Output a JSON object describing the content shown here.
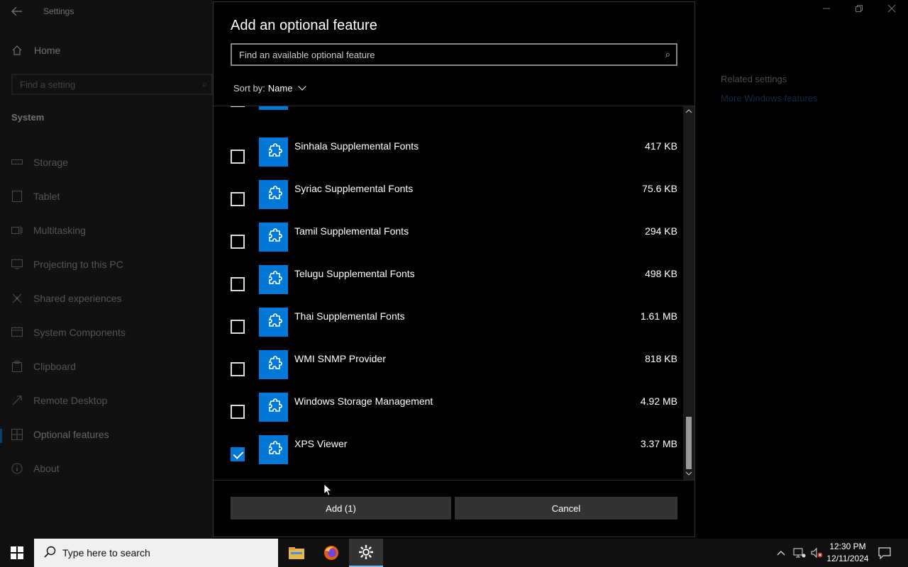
{
  "window": {
    "title": "Settings",
    "back_icon": "back-arrow-icon"
  },
  "sidebar": {
    "home_label": "Home",
    "search_placeholder": "Find a setting",
    "section_label": "System",
    "items": [
      {
        "label": "Storage",
        "icon": "storage-icon"
      },
      {
        "label": "Tablet",
        "icon": "tablet-icon"
      },
      {
        "label": "Multitasking",
        "icon": "multitasking-icon"
      },
      {
        "label": "Projecting to this PC",
        "icon": "projecting-icon"
      },
      {
        "label": "Shared experiences",
        "icon": "shared-experiences-icon"
      },
      {
        "label": "System Components",
        "icon": "system-components-icon"
      },
      {
        "label": "Clipboard",
        "icon": "clipboard-icon"
      },
      {
        "label": "Remote Desktop",
        "icon": "remote-desktop-icon"
      },
      {
        "label": "Optional features",
        "icon": "optional-features-icon",
        "active": true
      },
      {
        "label": "About",
        "icon": "info-icon"
      }
    ]
  },
  "related": {
    "heading": "Related settings",
    "link": "More Windows features"
  },
  "dialog": {
    "title": "Add an optional feature",
    "search_placeholder": "Find an available optional feature",
    "sort_label": "Sort by:",
    "sort_value": "Name",
    "features": [
      {
        "name": "Sinhala Supplemental Fonts",
        "size": "417 KB",
        "checked": false
      },
      {
        "name": "Syriac Supplemental Fonts",
        "size": "75.6 KB",
        "checked": false
      },
      {
        "name": "Tamil Supplemental Fonts",
        "size": "294 KB",
        "checked": false
      },
      {
        "name": "Telugu Supplemental Fonts",
        "size": "498 KB",
        "checked": false
      },
      {
        "name": "Thai Supplemental Fonts",
        "size": "1.61 MB",
        "checked": false
      },
      {
        "name": "WMI SNMP Provider",
        "size": "818 KB",
        "checked": false
      },
      {
        "name": "Windows Storage Management",
        "size": "4.92 MB",
        "checked": false
      },
      {
        "name": "XPS Viewer",
        "size": "3.37 MB",
        "checked": true
      }
    ],
    "add_label": "Add (1)",
    "cancel_label": "Cancel"
  },
  "taskbar": {
    "search_placeholder": "Type here to search",
    "time": "12:30 PM",
    "date": "12/11/2024",
    "apps": [
      "file-explorer-icon",
      "firefox-icon",
      "settings-gear-icon"
    ]
  }
}
